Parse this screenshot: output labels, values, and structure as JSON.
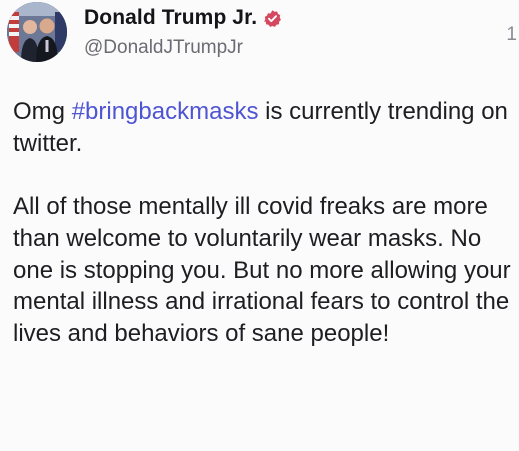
{
  "author": {
    "display_name": "Donald Trump Jr.",
    "handle": "@DonaldJTrumpJr",
    "verified_badge_color": "#d4495f",
    "avatar_icon": "profile-photo"
  },
  "meta": {
    "reply_count": "1"
  },
  "post": {
    "line1_prefix": "Omg ",
    "hashtag": "#bringbackmasks",
    "line1_suffix": " is currently trending on twitter.",
    "paragraph2": "All of those mentally ill covid freaks are more than welcome to voluntarily wear masks. No one is stopping you. But no more allowing your mental illness and irrational fears to control the lives and behaviors of sane people!"
  },
  "colors": {
    "hashtag": "#4f55d2",
    "text": "#1d1d22",
    "handle": "#6b6b73"
  }
}
